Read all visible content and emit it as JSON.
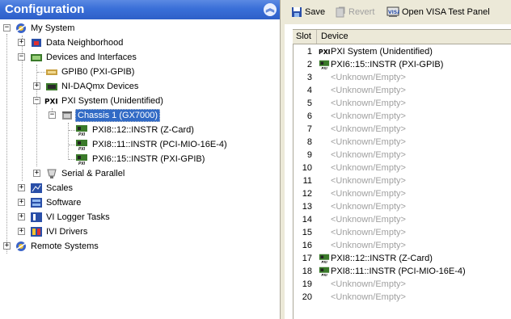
{
  "left_panel": {
    "title": "Configuration",
    "collapse_glyph": "︽",
    "tree": {
      "my_system": "My System",
      "data_neighborhood": "Data Neighborhood",
      "devices_interfaces": "Devices and Interfaces",
      "gpib0": "GPIB0 (PXI-GPIB)",
      "nidaqmx": "NI-DAQmx Devices",
      "pxi_system": "PXI System (Unidentified)",
      "chassis": "Chassis 1 (GX7000)",
      "pxi8_12": "PXI8::12::INSTR (Z-Card)",
      "pxi8_11": "PXI8::11::INSTR (PCI-MIO-16E-4)",
      "pxi6_15": "PXI6::15::INSTR (PXI-GPIB)",
      "serial_parallel": "Serial & Parallel",
      "scales": "Scales",
      "software": "Software",
      "vi_logger": "VI Logger Tasks",
      "ivi_drivers": "IVI Drivers",
      "remote_systems": "Remote Systems"
    }
  },
  "toolbar": {
    "save": "Save",
    "revert": "Revert",
    "open_visa": "Open VISA Test Panel"
  },
  "grid": {
    "headers": {
      "slot": "Slot",
      "device": "Device"
    },
    "rows": [
      {
        "slot": "1",
        "device": "PXI System (Unidentified)",
        "icon": "pxi-logo",
        "empty": false
      },
      {
        "slot": "2",
        "device": "PXI6::15::INSTR (PXI-GPIB)",
        "icon": "pxi-card",
        "empty": false
      },
      {
        "slot": "3",
        "device": "<Unknown/Empty>",
        "empty": true
      },
      {
        "slot": "4",
        "device": "<Unknown/Empty>",
        "empty": true
      },
      {
        "slot": "5",
        "device": "<Unknown/Empty>",
        "empty": true
      },
      {
        "slot": "6",
        "device": "<Unknown/Empty>",
        "empty": true
      },
      {
        "slot": "7",
        "device": "<Unknown/Empty>",
        "empty": true
      },
      {
        "slot": "8",
        "device": "<Unknown/Empty>",
        "empty": true
      },
      {
        "slot": "9",
        "device": "<Unknown/Empty>",
        "empty": true
      },
      {
        "slot": "10",
        "device": "<Unknown/Empty>",
        "empty": true
      },
      {
        "slot": "11",
        "device": "<Unknown/Empty>",
        "empty": true
      },
      {
        "slot": "12",
        "device": "<Unknown/Empty>",
        "empty": true
      },
      {
        "slot": "13",
        "device": "<Unknown/Empty>",
        "empty": true
      },
      {
        "slot": "14",
        "device": "<Unknown/Empty>",
        "empty": true
      },
      {
        "slot": "15",
        "device": "<Unknown/Empty>",
        "empty": true
      },
      {
        "slot": "16",
        "device": "<Unknown/Empty>",
        "empty": true
      },
      {
        "slot": "17",
        "device": "PXI8::12::INSTR (Z-Card)",
        "icon": "pxi-card",
        "empty": false
      },
      {
        "slot": "18",
        "device": "PXI8::11::INSTR (PCI-MIO-16E-4)",
        "icon": "pxi-card",
        "empty": false
      },
      {
        "slot": "19",
        "device": "<Unknown/Empty>",
        "empty": true
      },
      {
        "slot": "20",
        "device": "<Unknown/Empty>",
        "empty": true
      }
    ]
  },
  "colors": {
    "title_bar": "#3a6fd8",
    "selection": "#316ac5",
    "chrome": "#ece9d8",
    "empty_text": "#a0a0a0"
  }
}
